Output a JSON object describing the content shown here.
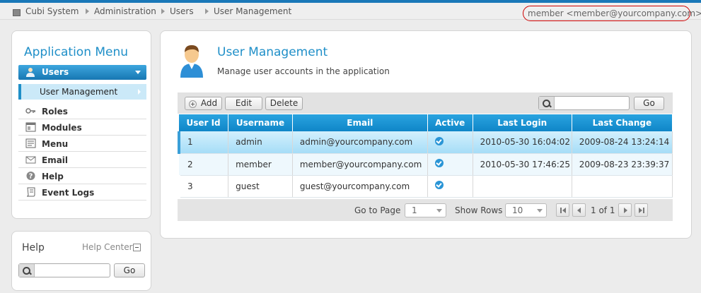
{
  "breadcrumb": [
    "Cubi System",
    "Administration",
    "Users",
    "User Management"
  ],
  "user_menu": "member <member@yourcompany.com>",
  "app_menu": {
    "title": "Application Menu",
    "active_group": "Users",
    "active_item": "User Management",
    "items": [
      {
        "label": "Roles",
        "icon": "key-icon"
      },
      {
        "label": "Modules",
        "icon": "window-icon"
      },
      {
        "label": "Menu",
        "icon": "menu-icon"
      },
      {
        "label": "Email",
        "icon": "envelope-icon"
      },
      {
        "label": "Help",
        "icon": "question-icon"
      },
      {
        "label": "Event Logs",
        "icon": "scroll-icon"
      }
    ]
  },
  "help": {
    "title": "Help",
    "center_link": "Help Center",
    "search_placeholder": "",
    "go_label": "Go"
  },
  "page": {
    "title": "User Management",
    "subtitle": "Manage user accounts in the application"
  },
  "toolbar": {
    "add_label": "Add",
    "edit_label": "Edit",
    "delete_label": "Delete",
    "search_placeholder": "",
    "go_label": "Go"
  },
  "grid": {
    "columns": [
      "User Id",
      "Username",
      "Email",
      "Active",
      "Last Login",
      "Last Change"
    ],
    "rows": [
      {
        "id": "1",
        "username": "admin",
        "email": "admin@yourcompany.com",
        "active": true,
        "last_login": "2010-05-30 16:04:02",
        "last_change": "2009-08-24 13:24:14"
      },
      {
        "id": "2",
        "username": "member",
        "email": "member@yourcompany.com",
        "active": true,
        "last_login": "2010-05-30 17:46:25",
        "last_change": "2009-08-23 23:39:37"
      },
      {
        "id": "3",
        "username": "guest",
        "email": "guest@yourcompany.com",
        "active": true,
        "last_login": "",
        "last_change": ""
      }
    ]
  },
  "pager": {
    "goto_label": "Go to Page",
    "goto_value": "1",
    "rows_label": "Show Rows",
    "rows_value": "10",
    "page_info": "1 of 1"
  },
  "colors": {
    "accent": "#1f8fc8",
    "header": "#0f86c8",
    "selected_row": "#a6ddf7",
    "user_pill_border": "#cc0000"
  }
}
